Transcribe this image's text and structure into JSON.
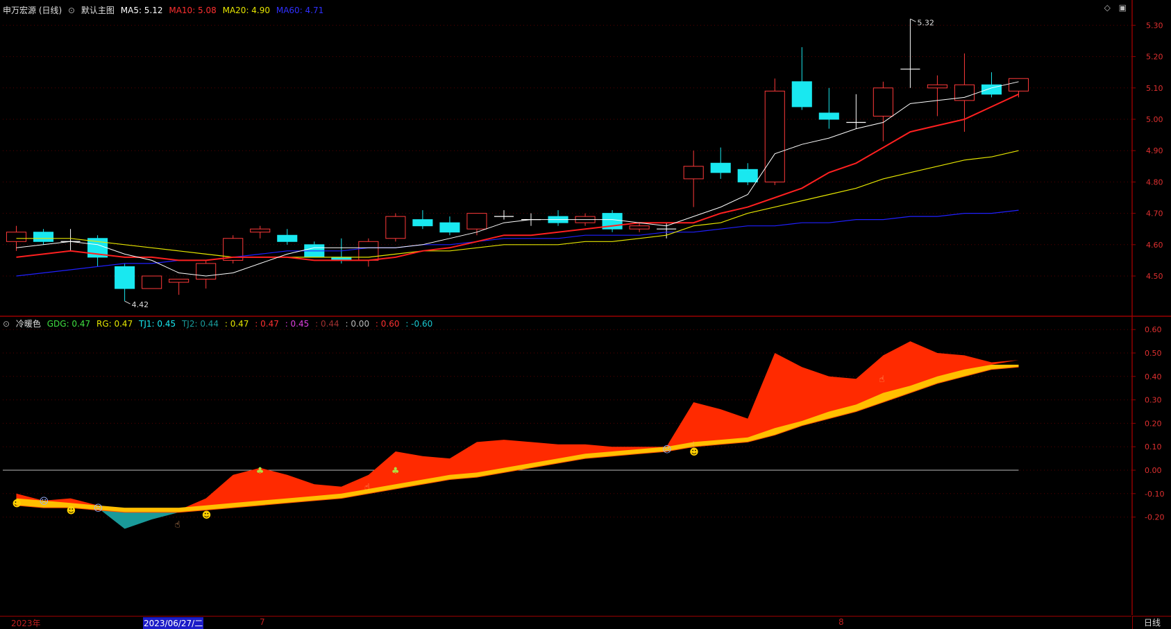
{
  "main_header": {
    "stock": "申万宏源 (日线)",
    "chart_name": "默认主图",
    "ma5": "MA5: 5.12",
    "ma10": "MA10: 5.08",
    "ma20": "MA20: 4.90",
    "ma60": "MA60: 4.71"
  },
  "indicator_header": {
    "name": "冷暖色",
    "gdg": "GDG: 0.47",
    "rg": "RG: 0.47",
    "tj1": "TJ1: 0.45",
    "tj2": "TJ2: 0.44",
    "v1": ": 0.47",
    "v2": ": 0.47",
    "v3": ": 0.45",
    "v4": ": 0.44",
    "v5": ": 0.00",
    "v6": ": 0.60",
    "v7": ": -0.60"
  },
  "price_axis_labels": [
    "5.30",
    "5.20",
    "5.10",
    "5.00",
    "4.90",
    "4.80",
    "4.70",
    "4.60",
    "4.50"
  ],
  "indicator_axis_labels": [
    "0.60",
    "0.50",
    "0.40",
    "0.30",
    "0.20",
    "0.10",
    "0.00",
    "-0.10",
    "-0.20"
  ],
  "annotations": {
    "high": "5.32",
    "low": "4.42"
  },
  "timebar": {
    "year": "2023年",
    "cursor_date": "2023/06/27/二",
    "month7": "7",
    "month8": "8",
    "period": "日线"
  },
  "colors": {
    "up": "#ff3a3a",
    "down": "#19e8f0",
    "ma5": "#ffffff",
    "ma10": "#ff2020",
    "ma20": "#e6e600",
    "ma60": "#2020ff",
    "warm": "#ff2a00",
    "gold": "#ffbf00",
    "cool": "#1a9a9a"
  },
  "chart_data": [
    {
      "type": "candlestick",
      "title": "申万宏源 (日线)",
      "ylim": [
        4.42,
        5.36
      ],
      "y_ticks": [
        4.5,
        4.6,
        4.7,
        4.8,
        4.9,
        5.0,
        5.1,
        5.2,
        5.3
      ],
      "ohlc": [
        [
          4.61,
          4.66,
          4.58,
          4.64
        ],
        [
          4.64,
          4.65,
          4.6,
          4.61
        ],
        [
          4.61,
          4.65,
          4.58,
          4.61
        ],
        [
          4.62,
          4.63,
          4.53,
          4.56
        ],
        [
          4.53,
          4.54,
          4.42,
          4.46
        ],
        [
          4.46,
          4.5,
          4.46,
          4.5
        ],
        [
          4.48,
          4.49,
          4.44,
          4.49
        ],
        [
          4.49,
          4.55,
          4.46,
          4.54
        ],
        [
          4.55,
          4.63,
          4.54,
          4.62
        ],
        [
          4.64,
          4.66,
          4.62,
          4.65
        ],
        [
          4.63,
          4.65,
          4.6,
          4.61
        ],
        [
          4.6,
          4.61,
          4.56,
          4.56
        ],
        [
          4.56,
          4.62,
          4.54,
          4.55
        ],
        [
          4.55,
          4.62,
          4.53,
          4.61
        ],
        [
          4.62,
          4.7,
          4.61,
          4.69
        ],
        [
          4.68,
          4.71,
          4.65,
          4.66
        ],
        [
          4.67,
          4.69,
          4.63,
          4.64
        ],
        [
          4.65,
          4.7,
          4.63,
          4.7
        ],
        [
          4.69,
          4.71,
          4.68,
          4.69
        ],
        [
          4.68,
          4.7,
          4.66,
          4.68
        ],
        [
          4.69,
          4.71,
          4.66,
          4.67
        ],
        [
          4.67,
          4.7,
          4.66,
          4.69
        ],
        [
          4.7,
          4.71,
          4.64,
          4.65
        ],
        [
          4.65,
          4.67,
          4.64,
          4.66
        ],
        [
          4.65,
          4.67,
          4.62,
          4.65
        ],
        [
          4.81,
          4.9,
          4.72,
          4.85
        ],
        [
          4.86,
          4.91,
          4.81,
          4.83
        ],
        [
          4.84,
          4.86,
          4.79,
          4.8
        ],
        [
          4.8,
          5.13,
          4.79,
          5.09
        ],
        [
          5.12,
          5.23,
          5.03,
          5.04
        ],
        [
          5.02,
          5.1,
          4.97,
          5.0
        ],
        [
          4.99,
          5.08,
          4.97,
          4.99
        ],
        [
          5.01,
          5.12,
          4.93,
          5.1
        ],
        [
          5.16,
          5.32,
          5.1,
          5.16
        ],
        [
          5.1,
          5.14,
          5.01,
          5.11
        ],
        [
          5.06,
          5.21,
          4.96,
          5.11
        ],
        [
          5.11,
          5.15,
          5.07,
          5.08
        ],
        [
          5.09,
          5.13,
          5.07,
          5.13
        ]
      ],
      "ma5": [
        4.59,
        4.6,
        4.61,
        4.6,
        4.57,
        4.55,
        4.51,
        4.5,
        4.51,
        4.54,
        4.57,
        4.59,
        4.59,
        4.59,
        4.59,
        4.6,
        4.62,
        4.64,
        4.67,
        4.68,
        4.68,
        4.68,
        4.68,
        4.67,
        4.66,
        4.69,
        4.72,
        4.76,
        4.89,
        4.92,
        4.94,
        4.97,
        4.99,
        5.05,
        5.06,
        5.07,
        5.1,
        5.12
      ],
      "ma10": [
        4.56,
        4.57,
        4.58,
        4.57,
        4.56,
        4.56,
        4.55,
        4.55,
        4.56,
        4.56,
        4.56,
        4.55,
        4.55,
        4.55,
        4.56,
        4.58,
        4.59,
        4.61,
        4.63,
        4.63,
        4.64,
        4.65,
        4.66,
        4.67,
        4.67,
        4.67,
        4.7,
        4.72,
        4.75,
        4.78,
        4.83,
        4.86,
        4.91,
        4.96,
        4.98,
        5.0,
        5.04,
        5.08
      ],
      "ma20": [
        4.62,
        4.62,
        4.62,
        4.61,
        4.6,
        4.59,
        4.58,
        4.57,
        4.56,
        4.56,
        4.56,
        4.56,
        4.56,
        4.56,
        4.57,
        4.58,
        4.58,
        4.59,
        4.6,
        4.6,
        4.6,
        4.61,
        4.61,
        4.62,
        4.63,
        4.66,
        4.67,
        4.7,
        4.72,
        4.74,
        4.76,
        4.78,
        4.81,
        4.83,
        4.85,
        4.87,
        4.88,
        4.9
      ],
      "ma60": [
        4.5,
        4.51,
        4.52,
        4.53,
        4.54,
        4.54,
        4.55,
        4.55,
        4.56,
        4.57,
        4.58,
        4.58,
        4.58,
        4.59,
        4.59,
        4.6,
        4.6,
        4.61,
        4.62,
        4.62,
        4.62,
        4.63,
        4.63,
        4.63,
        4.64,
        4.64,
        4.65,
        4.66,
        4.66,
        4.67,
        4.67,
        4.68,
        4.68,
        4.69,
        4.69,
        4.7,
        4.7,
        4.71
      ]
    },
    {
      "type": "area",
      "title": "冷暖色",
      "ylim": [
        -0.33,
        0.64
      ],
      "y_ticks": [
        -0.2,
        -0.1,
        0.0,
        0.1,
        0.2,
        0.3,
        0.4,
        0.5,
        0.6
      ],
      "series": [
        {
          "name": "GDG",
          "values": [
            -0.1,
            -0.13,
            -0.12,
            -0.15,
            -0.25,
            -0.21,
            -0.18,
            -0.12,
            -0.02,
            0.01,
            -0.02,
            -0.06,
            -0.07,
            -0.02,
            0.08,
            0.06,
            0.05,
            0.12,
            0.13,
            0.12,
            0.11,
            0.11,
            0.1,
            0.1,
            0.1,
            0.29,
            0.26,
            0.22,
            0.5,
            0.44,
            0.4,
            0.39,
            0.49,
            0.55,
            0.5,
            0.49,
            0.46,
            0.47
          ]
        },
        {
          "name": "RG",
          "values": [
            -0.14,
            -0.15,
            -0.15,
            -0.16,
            -0.17,
            -0.17,
            -0.17,
            -0.16,
            -0.15,
            -0.14,
            -0.13,
            -0.12,
            -0.11,
            -0.09,
            -0.07,
            -0.05,
            -0.03,
            -0.02,
            0.0,
            0.02,
            0.04,
            0.06,
            0.07,
            0.08,
            0.09,
            0.11,
            0.12,
            0.13,
            0.16,
            0.2,
            0.23,
            0.26,
            0.3,
            0.34,
            0.38,
            0.41,
            0.45,
            0.47
          ]
        },
        {
          "name": "TJ1",
          "values": [
            -0.12,
            -0.13,
            -0.14,
            -0.15,
            -0.16,
            -0.16,
            -0.16,
            -0.15,
            -0.14,
            -0.13,
            -0.12,
            -0.11,
            -0.1,
            -0.08,
            -0.06,
            -0.04,
            -0.02,
            -0.01,
            0.01,
            0.03,
            0.05,
            0.07,
            0.08,
            0.09,
            0.1,
            0.12,
            0.13,
            0.14,
            0.18,
            0.21,
            0.25,
            0.28,
            0.33,
            0.36,
            0.4,
            0.43,
            0.45,
            0.45
          ]
        },
        {
          "name": "TJ2",
          "values": [
            -0.15,
            -0.16,
            -0.16,
            -0.17,
            -0.18,
            -0.18,
            -0.18,
            -0.17,
            -0.16,
            -0.15,
            -0.14,
            -0.13,
            -0.12,
            -0.1,
            -0.08,
            -0.06,
            -0.04,
            -0.03,
            -0.01,
            0.01,
            0.03,
            0.05,
            0.06,
            0.07,
            0.08,
            0.1,
            0.11,
            0.12,
            0.15,
            0.19,
            0.22,
            0.25,
            0.29,
            0.33,
            0.37,
            0.4,
            0.43,
            0.44
          ]
        }
      ],
      "hlines": [
        0.0
      ]
    }
  ]
}
